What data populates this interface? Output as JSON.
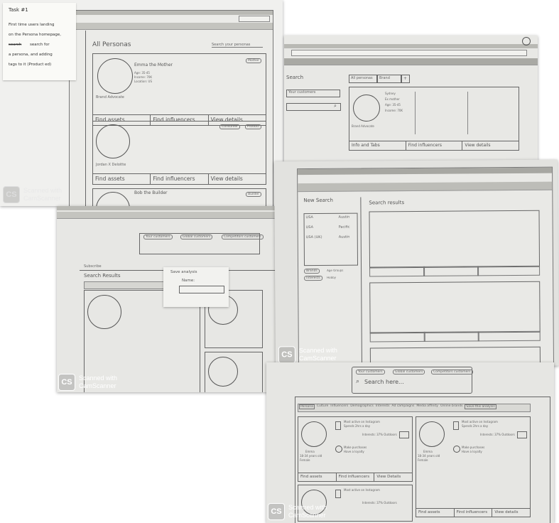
{
  "note": {
    "title": "Task #1",
    "lines": [
      "First time users landing",
      "on the Persona homepage,",
      "search for",
      "a persona, and adding",
      "tags to it (Product ed)"
    ],
    "struck_word": "search"
  },
  "scanner": {
    "line1": "Scanned with",
    "line2": "CamScanner",
    "logo": "CS"
  },
  "sheet1": {
    "section_title": "All Personas",
    "search_placeholder": "Search your personas",
    "cards": [
      {
        "name": "Emma the Mother",
        "details": [
          "Age: 35-45",
          "Income: 70K",
          "Location: US"
        ],
        "label": "Brand Advocate",
        "tags": [
          "Mother"
        ]
      },
      {
        "name": "",
        "details": [],
        "label": "Jordan X Deloitte",
        "tags": [
          "Consumer",
          "Product"
        ]
      },
      {
        "name": "Bob the Builder",
        "details": [],
        "label": "",
        "tags": [
          "Builder"
        ]
      }
    ],
    "buttons": [
      "Find assets",
      "Find influencers",
      "View details"
    ]
  },
  "sheet2": {
    "sidebar_title": "Search",
    "dropdown": "Your customers",
    "tabs": [
      "All personas",
      "Brand",
      "+"
    ],
    "persona_label": "Brand Advocate",
    "persona_lines": [
      "Sydney",
      "Ex mother",
      "Age: 35-45",
      "Income: 70K"
    ],
    "buttons": [
      "Info and Tabs",
      "Find influencers",
      "View details"
    ]
  },
  "sheet3": {
    "dialog_title": "Save analysis",
    "dialog_field": "Name:",
    "filter_chips": [
      "Your customers",
      "Global customers",
      "Competitors customers"
    ],
    "search_results": "Search Results",
    "subscribe": "Subscribe"
  },
  "sheet4": {
    "title": "New Search",
    "results_title": "Search results",
    "locations": [
      [
        "USA",
        "Austin"
      ],
      [
        "USA",
        "Pacific"
      ],
      [
        "USA (UK)",
        "Austin"
      ]
    ],
    "filters": [
      "Brands",
      "Age Groups",
      "Interests",
      "Hobby"
    ]
  },
  "sheet5": {
    "filter_chips": [
      "Your customers",
      "Global customers",
      "Competitors customers"
    ],
    "search_placeholder": "Search here...",
    "tabs": [
      "Persona",
      "Culture",
      "Influencers",
      "Demographics",
      "Interests",
      "Ad campaigns",
      "Media affinity",
      "Online brands",
      "Save this analysis"
    ],
    "cards": [
      {
        "name": "Emma",
        "line2": "18-34 years old",
        "line3": "Female",
        "buttons": [
          "Find assets",
          "Find influencers",
          "View Details"
        ]
      },
      {
        "name": "Emma",
        "line2": "18-34 years old",
        "line3": "Female",
        "buttons": [
          "Find assets",
          "Find influencers",
          "View details"
        ]
      }
    ],
    "stats": [
      "Most active on Instagram",
      "Spends 2hrs a day",
      "Interests: 37% Outdoors",
      "Make purchases",
      "Have a loyalty"
    ]
  }
}
